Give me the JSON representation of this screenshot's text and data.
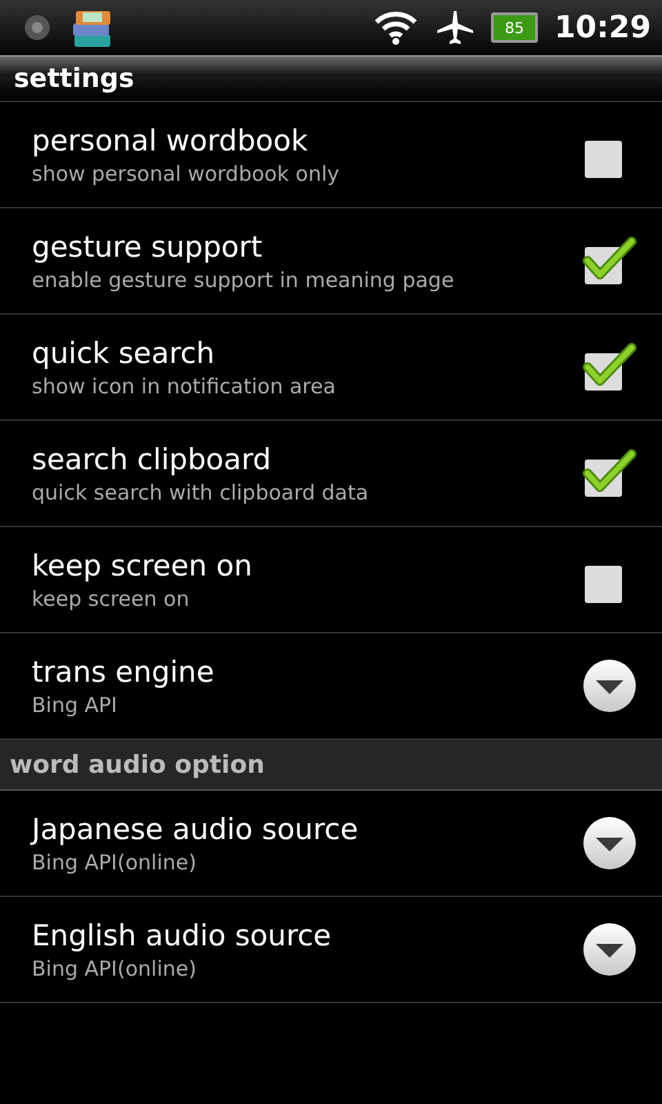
{
  "status_bar": {
    "battery": "85",
    "time": "10:29"
  },
  "sections": [
    {
      "title": "settings",
      "kind": "title",
      "items": [
        {
          "kind": "checkbox",
          "title": "personal wordbook",
          "summary": "show personal wordbook only",
          "checked": false
        },
        {
          "kind": "checkbox",
          "title": "gesture support",
          "summary": "enable gesture support in meaning page",
          "checked": true
        },
        {
          "kind": "checkbox",
          "title": "quick search",
          "summary": "show icon in notification area",
          "checked": true
        },
        {
          "kind": "checkbox",
          "title": "search clipboard",
          "summary": "quick search with clipboard data",
          "checked": true
        },
        {
          "kind": "checkbox",
          "title": "keep screen on",
          "summary": "keep screen on",
          "checked": false
        },
        {
          "kind": "list",
          "title": "trans engine",
          "summary": "Bing API"
        }
      ]
    },
    {
      "title": "word audio option",
      "kind": "category",
      "items": [
        {
          "kind": "list",
          "title": "Japanese audio source",
          "summary": "Bing API(online)"
        },
        {
          "kind": "list",
          "title": "English audio source",
          "summary": "Bing API(online)"
        }
      ]
    }
  ]
}
